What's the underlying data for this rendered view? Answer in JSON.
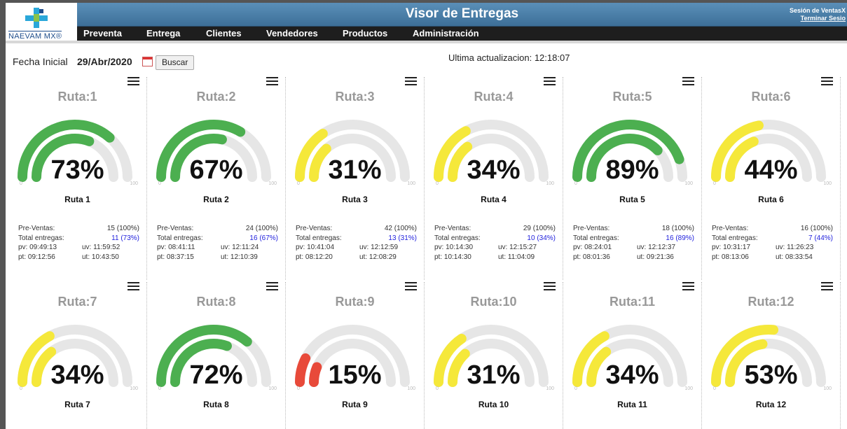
{
  "header": {
    "title": "Visor de Entregas",
    "session_label": "Sesión de VentasX",
    "logout_label": "Terminar Sesio",
    "logo_text": "NAEVAM MX®"
  },
  "nav": [
    "Preventa",
    "Entrega",
    "Clientes",
    "Vendedores",
    "Productos",
    "Administración"
  ],
  "filters": {
    "label": "Fecha Inicial",
    "date": "29/Abr/2020",
    "search_button": "Buscar",
    "last_update": "Ultima actualizacion: 12:18:07"
  },
  "colors": {
    "green": "#4caf50",
    "yellow": "#f5e83a",
    "red": "#e84a3a",
    "track": "#e6e6e6"
  },
  "routes": [
    {
      "title": "Ruta:1",
      "name": "Ruta 1",
      "pct": "73%",
      "level": 0.73,
      "color": "green",
      "pre_label": "Pre-Ventas:",
      "pre": "15 (100%)",
      "tot_label": "Total entregas:",
      "tot": "11 (73%)",
      "pv": "pv: 09:49:13",
      "uv": "uv: 11:59:52",
      "pt": "pt: 09:12:56",
      "ut": "ut: 10:43:50"
    },
    {
      "title": "Ruta:2",
      "name": "Ruta 2",
      "pct": "67%",
      "level": 0.67,
      "color": "green",
      "pre_label": "Pre-Ventas:",
      "pre": "24 (100%)",
      "tot_label": "Total entregas:",
      "tot": "16 (67%)",
      "pv": "pv: 08:41:11",
      "uv": "uv: 12:11:24",
      "pt": "pt: 08:37:15",
      "ut": "ut: 12:10:39"
    },
    {
      "title": "Ruta:3",
      "name": "Ruta 3",
      "pct": "31%",
      "level": 0.31,
      "color": "yellow",
      "pre_label": "Pre-Ventas:",
      "pre": "42 (100%)",
      "tot_label": "Total entregas:",
      "tot": "13 (31%)",
      "pv": "pv: 10:41:04",
      "uv": "uv: 12:12:59",
      "pt": "pt: 08:12:20",
      "ut": "ut: 12:08:29"
    },
    {
      "title": "Ruta:4",
      "name": "Ruta 4",
      "pct": "34%",
      "level": 0.34,
      "color": "yellow",
      "pre_label": "Pre-Ventas:",
      "pre": "29 (100%)",
      "tot_label": "Total entregas:",
      "tot": "10 (34%)",
      "pv": "pv: 10:14:30",
      "uv": "uv: 12:15:27",
      "pt": "pt: 10:14:30",
      "ut": "ut: 11:04:09"
    },
    {
      "title": "Ruta:5",
      "name": "Ruta 5",
      "pct": "89%",
      "level": 0.89,
      "color": "green",
      "pre_label": "Pre-Ventas:",
      "pre": "18 (100%)",
      "tot_label": "Total entregas:",
      "tot": "16 (89%)",
      "pv": "pv: 08:24:01",
      "uv": "uv: 12:12:37",
      "pt": "pt: 08:01:36",
      "ut": "ut: 09:21:36"
    },
    {
      "title": "Ruta:6",
      "name": "Ruta 6",
      "pct": "44%",
      "level": 0.44,
      "color": "yellow",
      "pre_label": "Pre-Ventas:",
      "pre": "16 (100%)",
      "tot_label": "Total entregas:",
      "tot": "7 (44%)",
      "pv": "pv: 10:31:17",
      "uv": "uv: 11:26:23",
      "pt": "pt: 08:13:06",
      "ut": "ut: 08:33:54"
    },
    {
      "title": "Ruta:7",
      "name": "Ruta 7",
      "pct": "34%",
      "level": 0.34,
      "color": "yellow"
    },
    {
      "title": "Ruta:8",
      "name": "Ruta 8",
      "pct": "72%",
      "level": 0.72,
      "color": "green"
    },
    {
      "title": "Ruta:9",
      "name": "Ruta 9",
      "pct": "15%",
      "level": 0.15,
      "color": "red"
    },
    {
      "title": "Ruta:10",
      "name": "Ruta 10",
      "pct": "31%",
      "level": 0.31,
      "color": "yellow"
    },
    {
      "title": "Ruta:11",
      "name": "Ruta 11",
      "pct": "34%",
      "level": 0.34,
      "color": "yellow"
    },
    {
      "title": "Ruta:12",
      "name": "Ruta 12",
      "pct": "53%",
      "level": 0.53,
      "color": "yellow"
    }
  ],
  "gauge_min": "0",
  "gauge_max": "100"
}
